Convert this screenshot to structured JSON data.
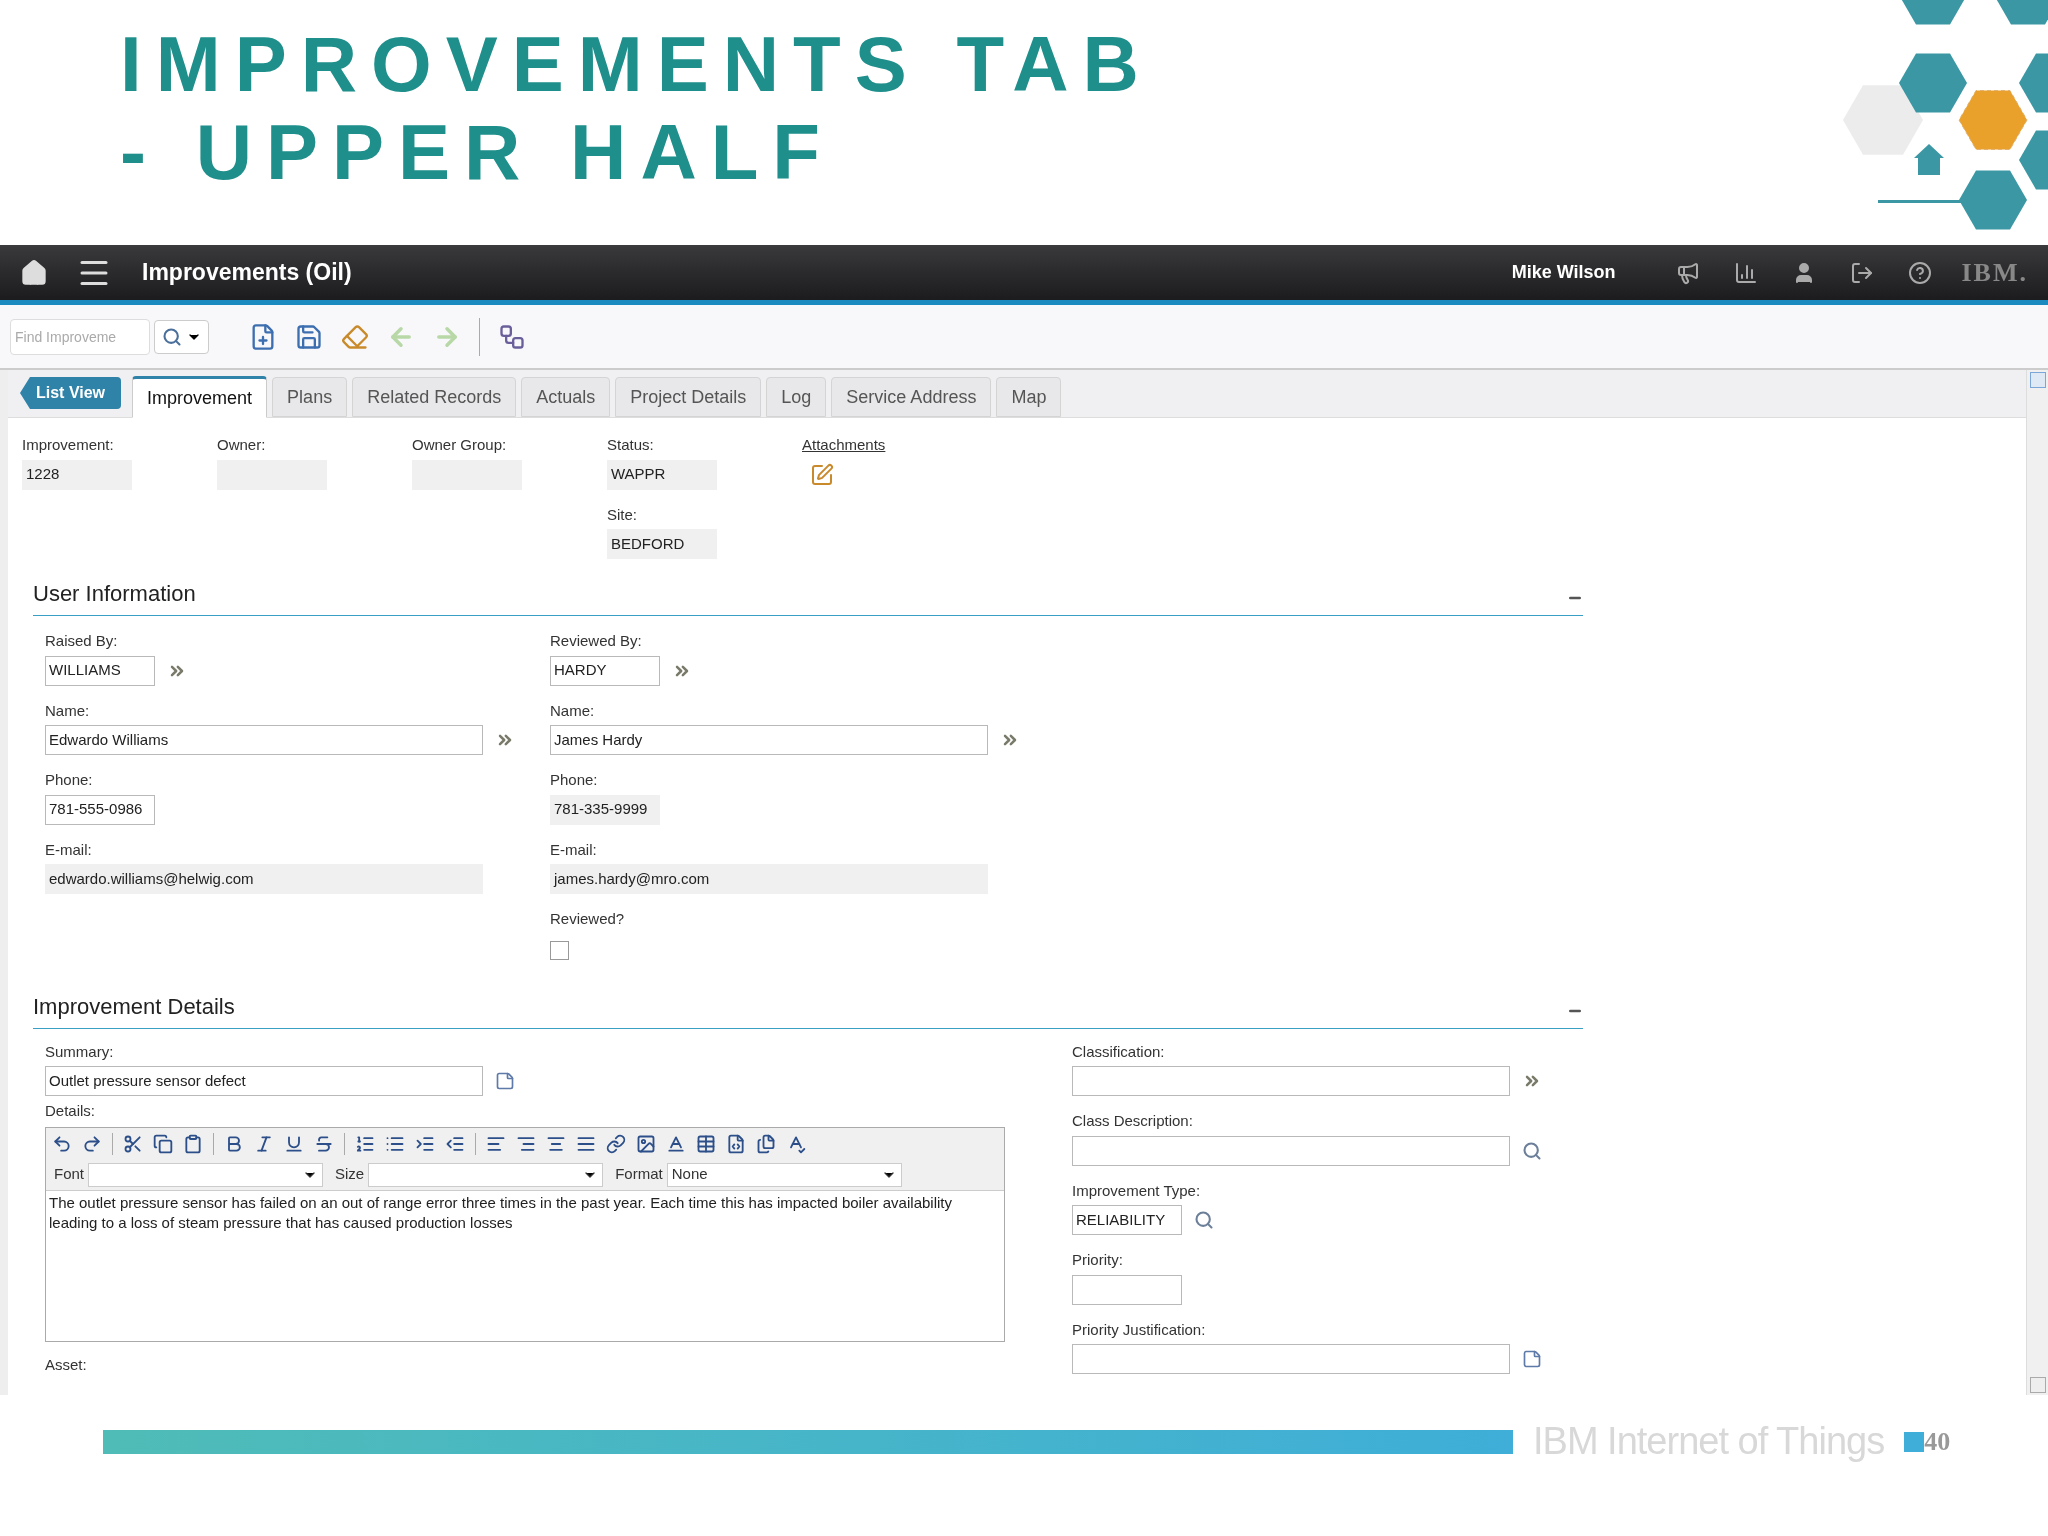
{
  "slide": {
    "title_lines": [
      "IMPROVEMENTS TAB",
      "- UPPER HALF"
    ],
    "footer": "IBM Internet of Things",
    "page": "40"
  },
  "app": {
    "title": "Improvements (Oil)",
    "user": "Mike Wilson",
    "logo": "IBM."
  },
  "toolbar": {
    "search_placeholder": "Find Improveme"
  },
  "list_view": "List View",
  "tabs": [
    {
      "label": "Improvement",
      "selected": true
    },
    {
      "label": "Plans",
      "selected": false
    },
    {
      "label": "Related Records",
      "selected": false
    },
    {
      "label": "Actuals",
      "selected": false
    },
    {
      "label": "Project Details",
      "selected": false
    },
    {
      "label": "Log",
      "selected": false
    },
    {
      "label": "Service Address",
      "selected": false
    },
    {
      "label": "Map",
      "selected": false
    }
  ],
  "header_columns": [
    [
      {
        "label": "Improvement:",
        "value": "1228",
        "readonly": true,
        "kind": "short"
      }
    ],
    [
      {
        "label": "Owner:",
        "readonly": true,
        "kind": "short"
      }
    ],
    [
      {
        "label": "Owner Group:",
        "readonly": true,
        "kind": "short"
      }
    ],
    [
      {
        "label": "Status:",
        "value": "WAPPR",
        "readonly": true,
        "kind": "short"
      },
      {
        "label": "Site:",
        "value": "BEDFORD",
        "readonly": true,
        "kind": "short"
      }
    ]
  ],
  "attachments": "Attachments",
  "user_information": {
    "title": "User Information",
    "expanded": true,
    "columns": [
      [
        {
          "label": "Raised By:",
          "value": "WILLIAMS",
          "readonly": false,
          "kind": "short_lookup"
        },
        {
          "label": "Name:",
          "value": "Edwardo Williams",
          "readonly": false,
          "kind": "long_lookup"
        },
        {
          "label": "Phone:",
          "value": "781-555-0986",
          "readonly": false,
          "kind": "short"
        },
        {
          "label": "E-mail:",
          "value": "edwardo.williams@helwig.com",
          "readonly": true,
          "kind": "long"
        }
      ],
      [
        {
          "label": "Reviewed By:",
          "value": "HARDY",
          "readonly": false,
          "kind": "short_lookup"
        },
        {
          "label": "Name:",
          "value": "James Hardy",
          "readonly": false,
          "kind": "long_lookup"
        },
        {
          "label": "Phone:",
          "value": "781-335-9999",
          "readonly": true,
          "kind": "short"
        },
        {
          "label": "E-mail:",
          "value": "james.hardy@mro.com",
          "readonly": true,
          "kind": "long"
        }
      ]
    ],
    "reviewed": {
      "label": "Reviewed?",
      "checked": false
    }
  },
  "improvement_details": {
    "title": "Improvement Details",
    "expanded": true,
    "summary": {
      "label": "Summary:",
      "value": "Outlet pressure sensor defect",
      "readonly": false,
      "kind": "long_note"
    },
    "details": {
      "label": "Details:",
      "font_label": "Font",
      "size_label": "Size",
      "format_label": "Format",
      "format_value": "None",
      "text": "The outlet pressure sensor has failed on an out of range error three times in the past year. Each time this has impacted boiler availability leading to a loss of steam pressure that has caused production losses"
    },
    "asset_label": "Asset:",
    "right": [
      {
        "label": "Classification:",
        "readonly": false,
        "kind": "long_lookup"
      },
      {
        "label": "Class Description:",
        "readonly": false,
        "kind": "long_search"
      },
      {
        "label": "Improvement Type:",
        "value": "RELIABILITY",
        "readonly": false,
        "kind": "short_search"
      },
      {
        "label": "Priority:",
        "readonly": false,
        "kind": "short"
      },
      {
        "label": "Priority Justification:",
        "readonly": false,
        "kind": "long_note"
      }
    ]
  }
}
